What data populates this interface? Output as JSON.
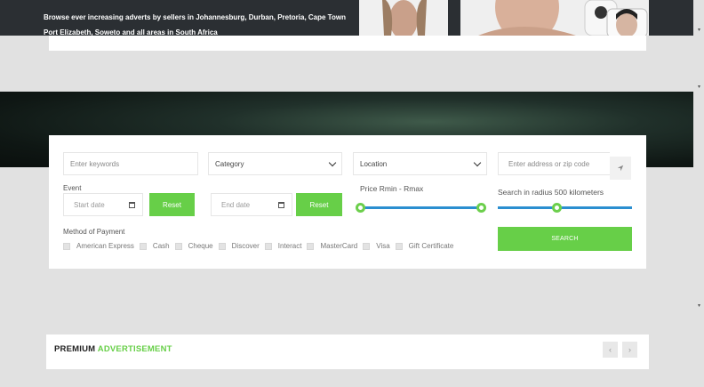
{
  "hero": {
    "line1": "Browse ever increasing adverts by sellers in Johannesburg, Durban, Pretoria, Cape Town",
    "line2": "Port Elizabeth, Soweto and all areas in South Africa"
  },
  "search": {
    "keywords_placeholder": "Enter keywords",
    "category_label": "Category",
    "location_label": "Location",
    "address_placeholder": "Enter address or zip code",
    "event_label": "Event",
    "start_date_placeholder": "Start date",
    "end_date_placeholder": "End date",
    "reset_label": "Reset",
    "price_label": "Price Rmin - Rmax",
    "radius_label": "Search in radius 500 kilometers",
    "payment_label": "Method of Payment",
    "payment_methods": [
      "American Express",
      "Cash",
      "Cheque",
      "Discover",
      "Interact",
      "MasterCard",
      "Visa",
      "Gift Certificate"
    ],
    "search_button": "SEARCH",
    "price_range": [
      0,
      1
    ],
    "radius_value": 0.45
  },
  "premium": {
    "title_dark": "PREMIUM",
    "title_green": "ADVERTISEMENT",
    "prev_icon": "chevron-left-icon",
    "next_icon": "chevron-right-icon"
  },
  "colors": {
    "accent_green": "#67cf48",
    "slider_blue": "#2b8fd0"
  }
}
